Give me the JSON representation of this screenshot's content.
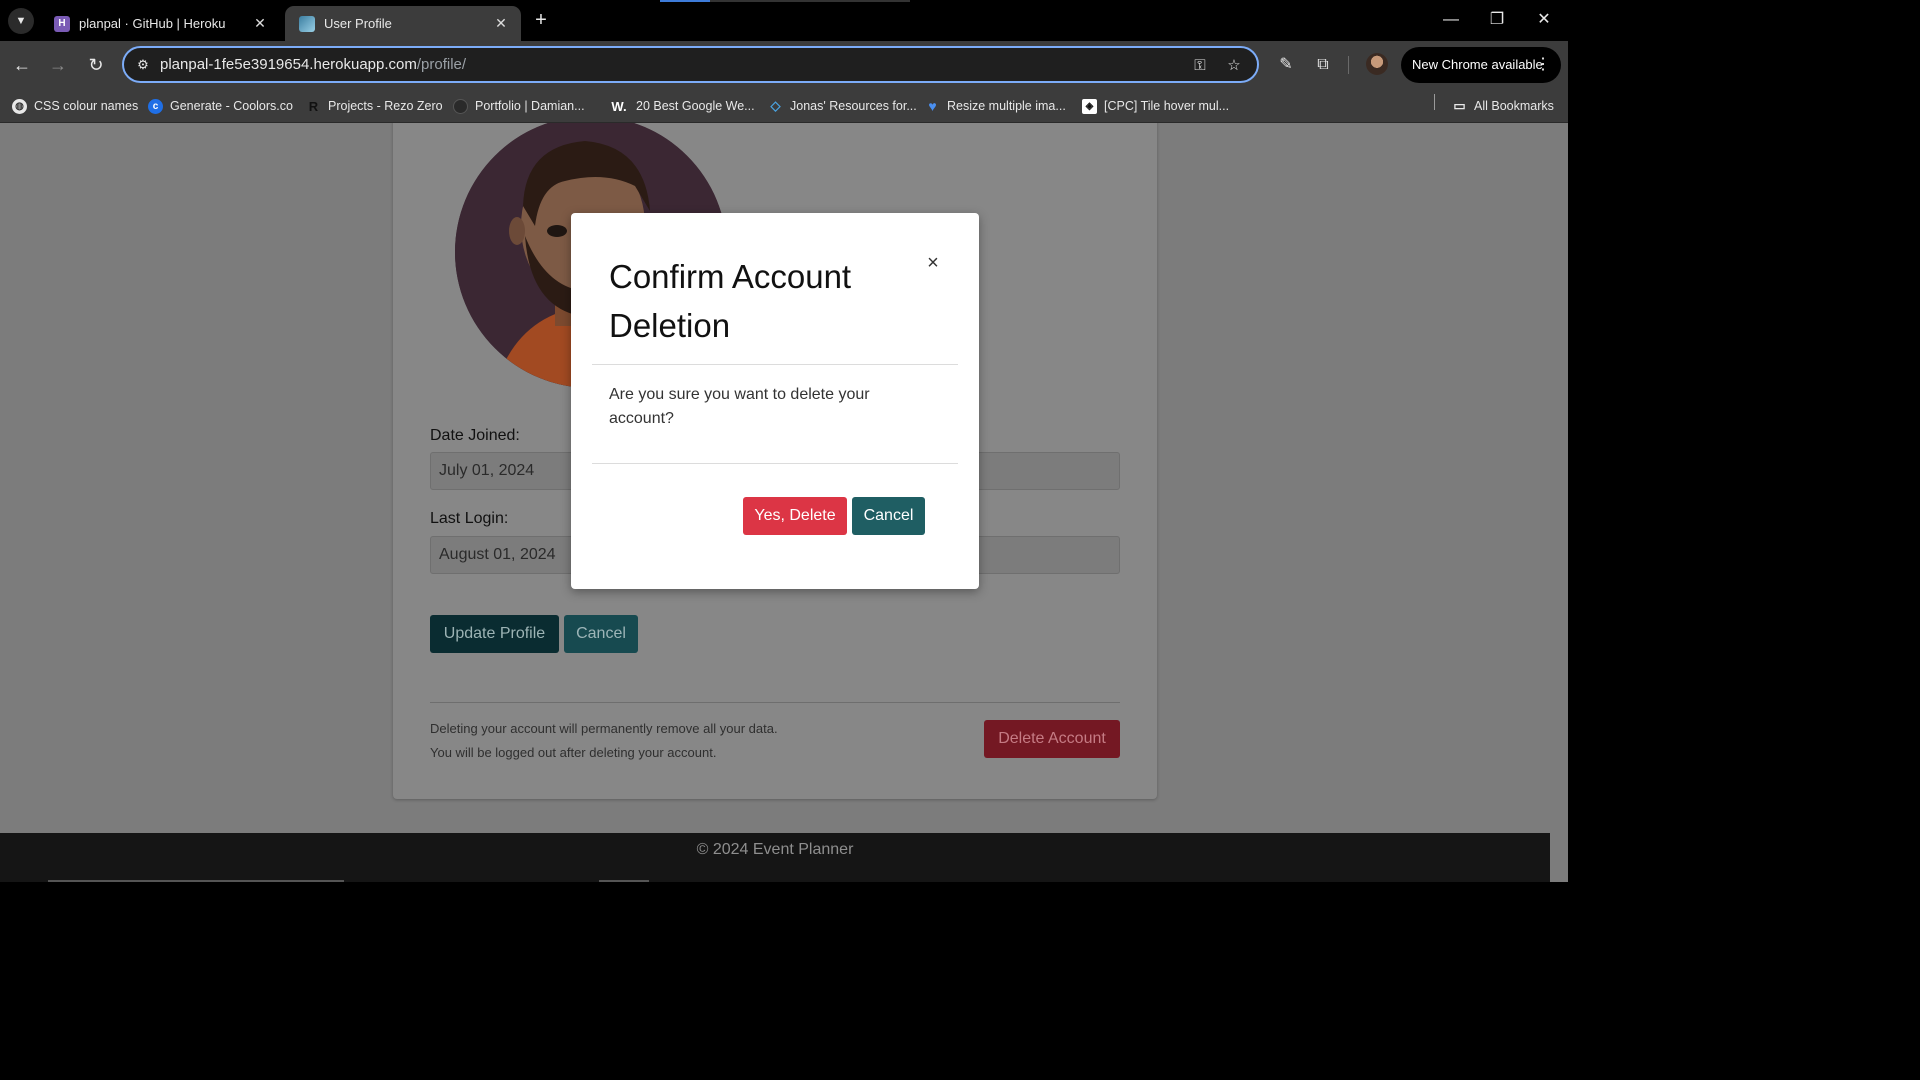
{
  "browser": {
    "tabs": [
      {
        "title": "planpal · GitHub | Heroku",
        "favicon": "H"
      },
      {
        "title": "User Profile"
      }
    ],
    "url_host": "planpal-1fe5e3919654.herokuapp.com",
    "url_path": "/profile/",
    "update_label": "New Chrome available",
    "bookmarks": [
      {
        "label": "CSS colour names",
        "icon": "globe-icon"
      },
      {
        "label": "Generate - Coolors.co",
        "icon": "coolors-icon"
      },
      {
        "label": "Projects - Rezo Zero",
        "icon": "R"
      },
      {
        "label": "Portfolio | Damian...",
        "icon": "portfolio-icon"
      },
      {
        "label": "20 Best Google We...",
        "icon": "W."
      },
      {
        "label": "Jonas' Resources for...",
        "icon": "diamond-icon"
      },
      {
        "label": "Resize multiple ima...",
        "icon": "heart-icon"
      },
      {
        "label": "[CPC] Tile hover mul...",
        "icon": "codepen-icon"
      }
    ],
    "all_bookmarks_label": "All Bookmarks"
  },
  "profile": {
    "date_joined_label": "Date Joined:",
    "date_joined_value": "July 01, 2024",
    "last_login_label": "Last Login:",
    "last_login_value": "August 01, 2024",
    "update_button": "Update Profile",
    "cancel_button": "Cancel",
    "delete_note_1": "Deleting your account will permanently remove all your data.",
    "delete_note_2": "You will be logged out after deleting your account.",
    "delete_button": "Delete Account"
  },
  "footer": {
    "text": "© 2024 Event Planner"
  },
  "modal": {
    "title": "Confirm Account Deletion",
    "close_glyph": "×",
    "body": "Are you sure you want to delete your account?",
    "confirm_button": "Yes, Delete",
    "cancel_button": "Cancel"
  },
  "colors": {
    "danger": "#dc3545",
    "teal": "#1f5e63",
    "dark_teal": "#0a2c31",
    "focus_ring": "#7cacf8"
  }
}
